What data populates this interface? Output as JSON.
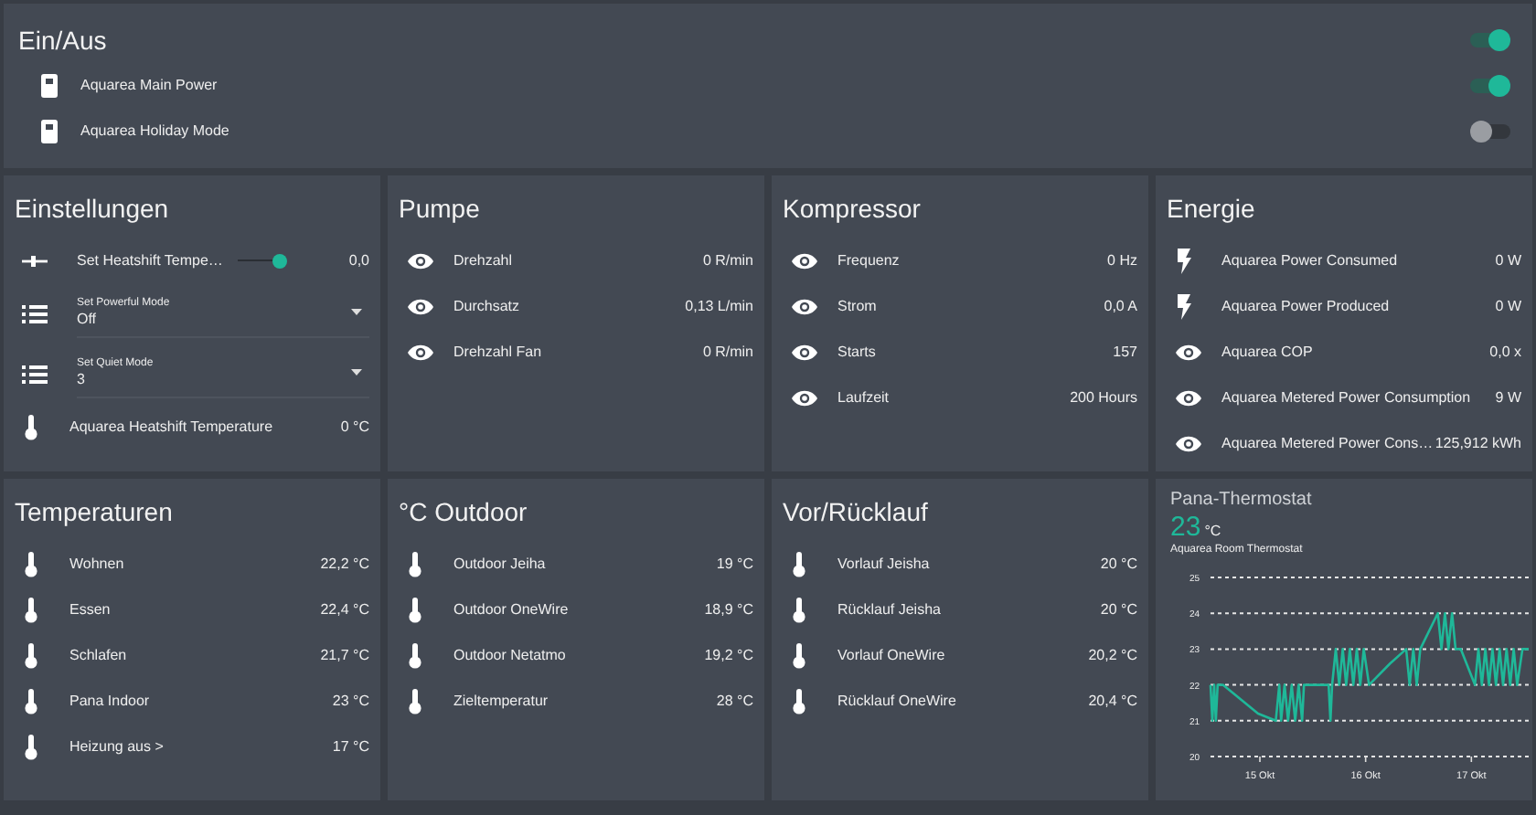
{
  "onoff": {
    "title": "Ein/Aus",
    "on": true,
    "rows": [
      {
        "kind": "switch",
        "label": "Aquarea Main Power",
        "on": true
      },
      {
        "kind": "switch",
        "label": "Aquarea Holiday Mode",
        "on": false
      }
    ]
  },
  "cards": [
    {
      "title": "Einstellungen",
      "rows": [
        {
          "kind": "slider",
          "label": "Set Heatshift Tempe…",
          "level": 0.9,
          "value": "0,0"
        },
        {
          "kind": "select",
          "label": "Set Powerful Mode",
          "value": "Off"
        },
        {
          "kind": "select",
          "label": "Set Quiet Mode",
          "value": "3"
        },
        {
          "kind": "temperature",
          "label": "Aquarea Heatshift Temperature",
          "value": "0 °C"
        }
      ]
    },
    {
      "title": "Pumpe",
      "rows": [
        {
          "kind": "reading",
          "label": "Drehzahl",
          "value": "0 R/min"
        },
        {
          "kind": "reading",
          "label": "Durchsatz",
          "value": "0,13 L/min"
        },
        {
          "kind": "reading",
          "label": "Drehzahl Fan",
          "value": "0 R/min"
        }
      ]
    },
    {
      "title": "Kompressor",
      "rows": [
        {
          "kind": "reading",
          "label": "Frequenz",
          "value": "0 Hz"
        },
        {
          "kind": "reading",
          "label": "Strom",
          "value": "0,0 A"
        },
        {
          "kind": "reading",
          "label": "Starts",
          "value": "157"
        },
        {
          "kind": "reading",
          "label": "Laufzeit",
          "value": "200 Hours"
        }
      ]
    },
    {
      "title": "Energie",
      "rows": [
        {
          "kind": "power",
          "label": "Aquarea Power Consumed",
          "value": "0 W"
        },
        {
          "kind": "power",
          "label": "Aquarea Power Produced",
          "value": "0 W"
        },
        {
          "kind": "reading",
          "label": "Aquarea COP",
          "value": "0,0 x"
        },
        {
          "kind": "reading",
          "label": "Aquarea Metered Power Consumption",
          "value": "9 W"
        },
        {
          "kind": "reading",
          "label": "Aquarea Metered Power Cons…",
          "value": "125,912 kWh"
        }
      ]
    },
    {
      "title": "Temperaturen",
      "rows": [
        {
          "kind": "temperature",
          "label": "Wohnen",
          "value": "22,2 °C"
        },
        {
          "kind": "temperature",
          "label": "Essen",
          "value": "22,4 °C"
        },
        {
          "kind": "temperature",
          "label": "Schlafen",
          "value": "21,7 °C"
        },
        {
          "kind": "temperature",
          "label": "Pana Indoor",
          "value": "23 °C"
        },
        {
          "kind": "temperature",
          "label": "Heizung aus >",
          "value": "17 °C"
        }
      ]
    },
    {
      "title": "°C Outdoor",
      "rows": [
        {
          "kind": "temperature",
          "label": "Outdoor Jeiha",
          "value": "19 °C"
        },
        {
          "kind": "temperature",
          "label": "Outdoor OneWire",
          "value": "18,9 °C"
        },
        {
          "kind": "temperature",
          "label": "Outdoor Netatmo",
          "value": "19,2 °C"
        },
        {
          "kind": "temperature",
          "label": "Zieltemperatur",
          "value": "28 °C"
        }
      ]
    },
    {
      "title": "Vor/Rücklauf",
      "rows": [
        {
          "kind": "temperature",
          "label": "Vorlauf Jeisha",
          "value": "20 °C"
        },
        {
          "kind": "temperature",
          "label": "Rücklauf Jeisha",
          "value": "20 °C"
        },
        {
          "kind": "temperature",
          "label": "Vorlauf OneWire",
          "value": "20,2 °C"
        },
        {
          "kind": "temperature",
          "label": "Rücklauf OneWire",
          "value": "20,4 °C"
        }
      ]
    }
  ],
  "thermostat": {
    "title": "Pana-Thermostat",
    "reading": "23",
    "unit": "°C",
    "name": "Aquarea Room Thermostat",
    "chart_data": {
      "type": "line",
      "x": [
        14.533,
        14.55,
        14.567,
        14.583,
        14.6,
        14.65,
        14.817,
        14.983,
        15.15,
        15.183,
        15.2,
        15.233,
        15.267,
        15.3,
        15.333,
        15.367,
        15.4,
        15.417,
        15.65,
        15.667,
        15.683,
        15.717,
        15.75,
        15.783,
        15.817,
        15.85,
        15.883,
        15.917,
        15.95,
        15.983,
        16.033,
        16.233,
        16.383,
        16.417,
        16.45,
        16.483,
        16.517,
        16.683,
        16.717,
        16.75,
        16.783,
        16.817,
        16.85,
        16.9,
        17.033,
        17.067,
        17.1,
        17.133,
        17.167,
        17.2,
        17.233,
        17.267,
        17.3,
        17.333,
        17.367,
        17.4,
        17.433,
        17.483,
        17.542
      ],
      "series": [
        {
          "color": "#1fb899",
          "values": [
            22,
            21,
            22,
            21,
            22,
            22,
            21.6,
            21.2,
            21,
            22,
            21,
            22,
            21,
            22,
            21,
            22,
            21,
            22,
            22,
            21,
            22,
            23,
            22,
            23,
            22,
            23,
            22,
            23,
            22,
            23,
            22,
            22.6,
            23,
            22,
            23,
            22,
            23,
            24,
            23,
            24,
            23,
            24,
            23,
            23,
            22,
            23,
            22,
            23,
            22,
            23,
            22,
            23,
            22,
            23,
            22,
            23,
            22,
            23,
            23
          ]
        }
      ],
      "grid": true,
      "xlim": [
        14.533,
        17.542
      ],
      "ylim": [
        20,
        25
      ],
      "xticks": [
        {
          "value": 15,
          "label": "15 Okt"
        },
        {
          "value": 16,
          "label": "16 Okt"
        },
        {
          "value": 17,
          "label": "17 Okt"
        }
      ],
      "yticks": [
        20,
        21,
        22,
        23,
        24,
        25
      ]
    }
  }
}
